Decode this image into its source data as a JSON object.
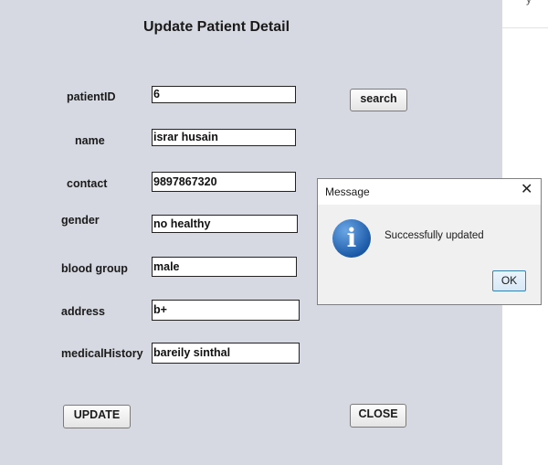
{
  "window": {
    "title": "Update Patient Detail",
    "strip_glyph": "y"
  },
  "form": {
    "fields": [
      {
        "label": "patientID",
        "value": "6"
      },
      {
        "label": "name",
        "value": "israr husain"
      },
      {
        "label": "contact",
        "value": "9897867320"
      },
      {
        "label": "gender",
        "value": "no healthy"
      },
      {
        "label": "blood group",
        "value": "male"
      },
      {
        "label": "address",
        "value": "b+"
      },
      {
        "label": "medicalHistory",
        "value": "bareily sinthal"
      }
    ],
    "search_label": "search",
    "update_label": "UPDATE",
    "close_label": "CLOSE"
  },
  "dialog": {
    "title": "Message",
    "close_glyph": "✕",
    "icon_glyph": "i",
    "message": "Successfully updated",
    "ok_label": "OK"
  }
}
